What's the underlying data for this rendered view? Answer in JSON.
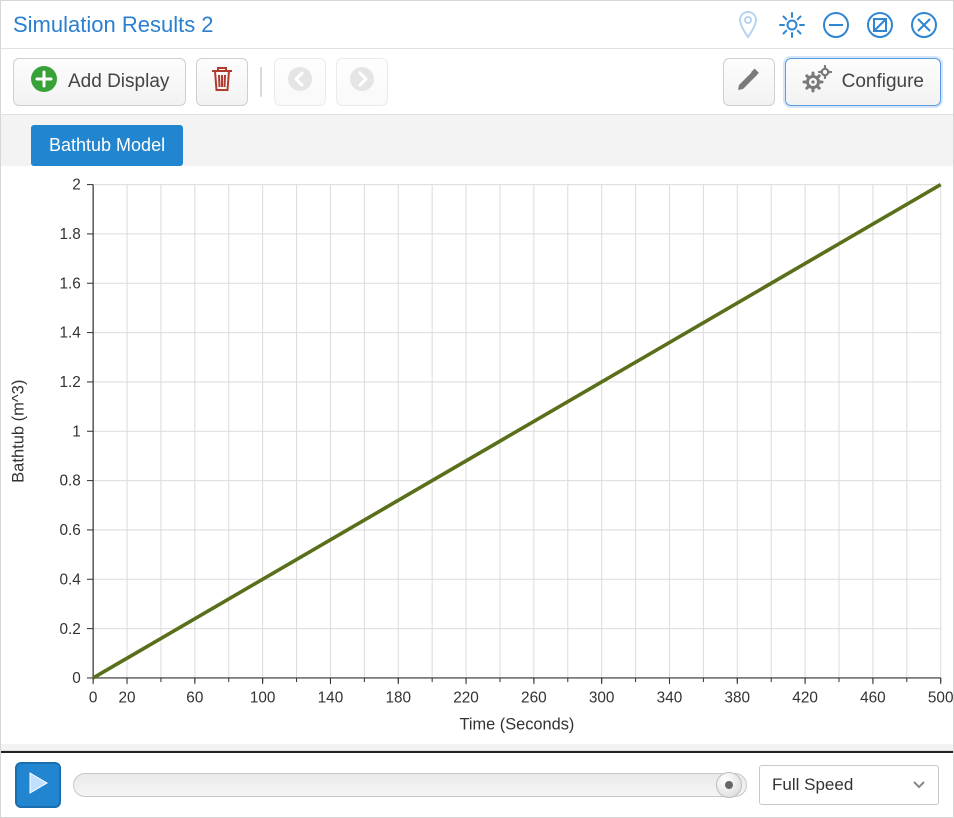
{
  "titlebar": {
    "title": "Simulation Results 2"
  },
  "toolbar": {
    "add_display_label": "Add Display",
    "configure_label": "Configure"
  },
  "tabs": {
    "active_label": "Bathtub Model"
  },
  "playback": {
    "speed_label": "Full Speed",
    "progress": 1.0
  },
  "chart_data": {
    "type": "line",
    "title": "",
    "xlabel": "Time (Seconds)",
    "ylabel": "Bathtub (m^3)",
    "xlim": [
      0,
      500
    ],
    "ylim": [
      0,
      2
    ],
    "x_ticks_major": [
      0,
      20,
      60,
      100,
      140,
      180,
      220,
      260,
      300,
      340,
      380,
      420,
      460,
      500
    ],
    "y_ticks": [
      0,
      0.2,
      0.4,
      0.6,
      0.8,
      1,
      1.2,
      1.4,
      1.6,
      1.8,
      2
    ],
    "x_grid_every": 20,
    "series": [
      {
        "name": "Bathtub",
        "color": "#5a6f1a",
        "x": [
          0,
          500
        ],
        "y": [
          0,
          2
        ]
      }
    ]
  }
}
